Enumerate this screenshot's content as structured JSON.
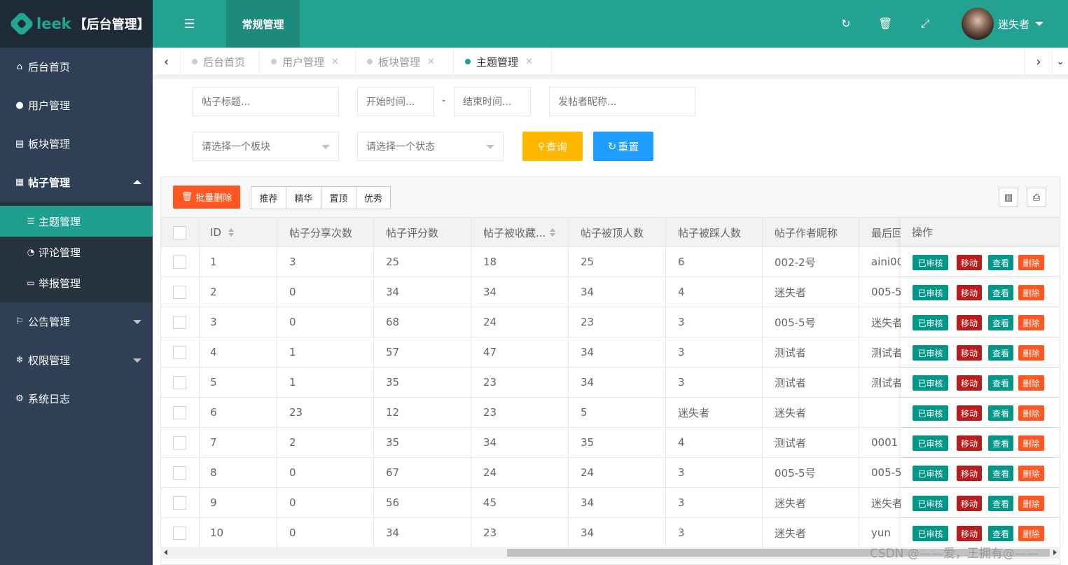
{
  "logo": {
    "brand": "leek",
    "system": "【后台管理】"
  },
  "sidebar": {
    "items": [
      {
        "label": "后台首页",
        "icon": "home-icon"
      },
      {
        "label": "用户管理",
        "icon": "user-icon"
      },
      {
        "label": "板块管理",
        "icon": "file-icon"
      },
      {
        "label": "帖子管理",
        "icon": "calendar-icon",
        "expanded": true
      },
      {
        "label": "公告管理",
        "icon": "flag-icon"
      },
      {
        "label": "权限管理",
        "icon": "snowflake-icon"
      },
      {
        "label": "系统日志",
        "icon": "gears-icon"
      }
    ],
    "subitems": [
      {
        "label": "主题管理",
        "icon": "bars-icon",
        "active": true
      },
      {
        "label": "评论管理",
        "icon": "comments-icon"
      },
      {
        "label": "举报管理",
        "icon": "newspaper-icon"
      }
    ]
  },
  "header": {
    "module": "常规管理",
    "username": "迷失者"
  },
  "tabs": [
    {
      "label": "后台首页"
    },
    {
      "label": "用户管理"
    },
    {
      "label": "板块管理"
    },
    {
      "label": "主题管理",
      "active": true
    }
  ],
  "search": {
    "title_placeholder": "帖子标题...",
    "start_placeholder": "开始时间...",
    "end_placeholder": "结束时间...",
    "nickname_placeholder": "发帖者昵称...",
    "range_sep": "-",
    "board_select": "请选择一个板块",
    "status_select": "请选择一个状态",
    "query_label": "查询",
    "reset_label": "重置"
  },
  "toolbar": {
    "batch_delete": "批量删除",
    "group": [
      "推荐",
      "精华",
      "置顶",
      "优秀"
    ]
  },
  "table": {
    "columns": [
      "ID",
      "帖子分享次数",
      "帖子评分数",
      "帖子被收藏...",
      "帖子被顶人数",
      "帖子被踩人数",
      "帖子作者昵称",
      "最后回",
      "操作"
    ],
    "actions": {
      "audit": "已审核",
      "move": "移动",
      "view": "查看",
      "delete": "删除"
    },
    "rows": [
      [
        "1",
        "3",
        "25",
        "18",
        "25",
        "6",
        "002-2号",
        "aini00"
      ],
      [
        "2",
        "0",
        "34",
        "34",
        "34",
        "4",
        "迷失者",
        "005-5"
      ],
      [
        "3",
        "0",
        "68",
        "24",
        "23",
        "3",
        "005-5号",
        "迷失者"
      ],
      [
        "4",
        "1",
        "57",
        "47",
        "34",
        "3",
        "测试者",
        "测试者"
      ],
      [
        "5",
        "1",
        "35",
        "23",
        "34",
        "3",
        "测试者",
        "测试者"
      ],
      [
        "6",
        "23",
        "12",
        "23",
        "5",
        "迷失者",
        "迷失者"
      ],
      [
        "7",
        "2",
        "35",
        "34",
        "35",
        "4",
        "测试者",
        "0001"
      ],
      [
        "8",
        "0",
        "67",
        "24",
        "24",
        "3",
        "005-5号",
        "005-5"
      ],
      [
        "9",
        "0",
        "56",
        "45",
        "34",
        "3",
        "迷失者",
        "迷失者"
      ],
      [
        "10",
        "0",
        "34",
        "23",
        "34",
        "3",
        "迷失者",
        "yun"
      ]
    ]
  },
  "watermark": "CSDN @——爱，王拥有@——",
  "colors": {
    "primary": "#1ea08f",
    "sidebar": "#2f4056",
    "warn": "#ffb800",
    "info": "#1e9fff",
    "danger": "#ff5722"
  }
}
